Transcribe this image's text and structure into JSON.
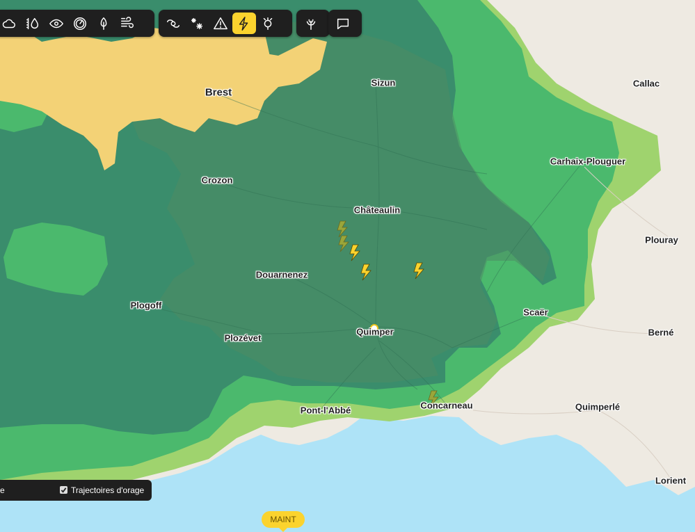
{
  "toolbar": {
    "group1": [
      "cloud-icon",
      "rain-gauge-icon",
      "eye-icon",
      "pressure-gauge-icon",
      "tree-icon",
      "wind-icon"
    ],
    "group2": [
      "cyclone-icon",
      "snow-icon",
      "warning-icon",
      "lightning-icon",
      "pollen-icon"
    ],
    "group3": [
      "plant-icon"
    ],
    "group4": [
      "comment-icon"
    ],
    "active": "lightning-icon"
  },
  "colors": {
    "sea": "#aee3f7",
    "land": "#eeeae2",
    "zone_light": "#9fd36e",
    "zone_mid": "#4bb96d",
    "zone_dark": "#3a8d6c",
    "zone_yellow": "#f3d276",
    "accent": "#fbd32e"
  },
  "cities": {
    "brest": "Brest",
    "sizun": "Sizun",
    "callac": "Callac",
    "carhaix": "Carhaix-Plouguer",
    "crozon": "Crozon",
    "chateaulin": "Châteaulin",
    "plouray": "Plouray",
    "douarnenez": "Douarnenez",
    "plogoff": "Plogoff",
    "scaer": "Scaër",
    "quimper": "Quimper",
    "berne": "Berné",
    "plozevet": "Plozévet",
    "pontlabbe": "Pont-l'Abbé",
    "concarneau": "Concarneau",
    "quimperle": "Quimperlé",
    "lorient": "Lorient"
  },
  "legend": {
    "fragment": "e",
    "checkbox_checked": true,
    "checkbox_label": "Trajectoires d'orage"
  },
  "marker": {
    "label": "MAINT"
  }
}
